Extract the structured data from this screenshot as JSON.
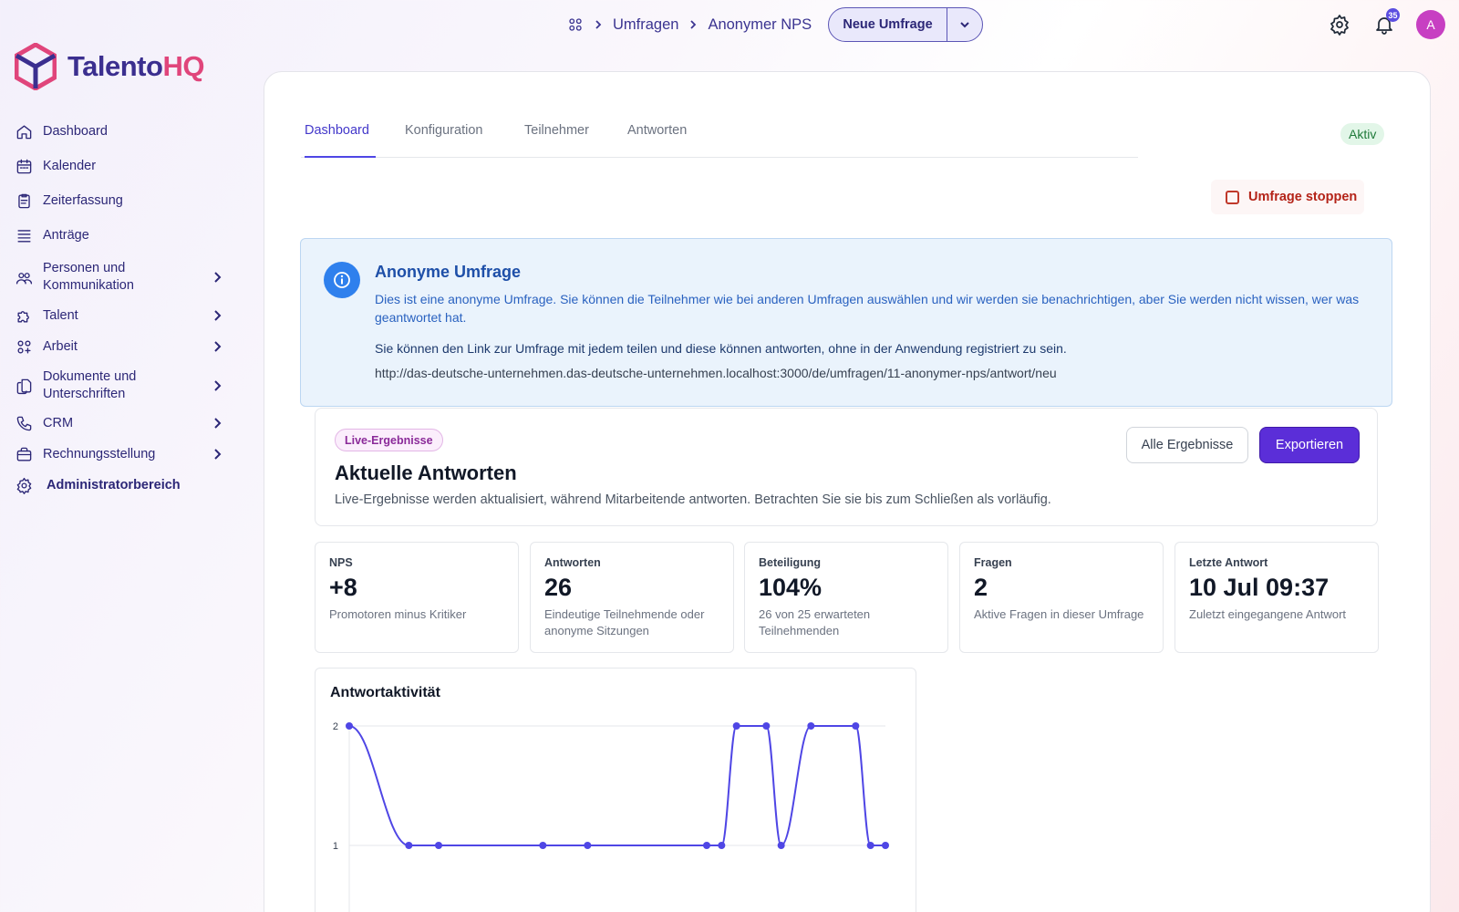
{
  "brand": {
    "name_part1": "Talento",
    "name_part2": "HQ",
    "color_primary": "#3b2f8f",
    "color_accent": "#e0457b"
  },
  "sidebar": {
    "items": [
      {
        "label": "Dashboard",
        "icon": "home-icon"
      },
      {
        "label": "Kalender",
        "icon": "calendar-icon"
      },
      {
        "label": "Zeiterfassung",
        "icon": "clipboard-icon"
      },
      {
        "label": "Anträge",
        "icon": "list-icon"
      },
      {
        "label": "Personen und Kommunikation",
        "icon": "people-icon",
        "has_children": true
      },
      {
        "label": "Talent",
        "icon": "puzzle-icon",
        "has_children": true
      },
      {
        "label": "Arbeit",
        "icon": "apps-icon",
        "has_children": true
      },
      {
        "label": "Dokumente und Unterschriften",
        "icon": "documents-icon",
        "has_children": true
      },
      {
        "label": "CRM",
        "icon": "phone-icon",
        "has_children": true
      },
      {
        "label": "Rechnungsstellung",
        "icon": "briefcase-icon",
        "has_children": true
      },
      {
        "label": "Administratorbereich",
        "icon": "gear-icon"
      }
    ]
  },
  "topbar": {
    "breadcrumb": [
      "Umfragen",
      "Anonymer NPS"
    ],
    "new_button": "Neue Umfrage",
    "notification_count": "35",
    "avatar_initial": "A"
  },
  "tabs": [
    "Dashboard",
    "Konfiguration",
    "Teilnehmer",
    "Antworten"
  ],
  "status": "Aktiv",
  "stop_button": "Umfrage stoppen",
  "info": {
    "title": "Anonyme Umfrage",
    "text1": "Dies ist eine anonyme Umfrage. Sie können die Teilnehmer wie bei anderen Umfragen auswählen und wir werden sie benachrichtigen, aber Sie werden nicht wissen, wer was geantwortet hat.",
    "text2": "Sie können den Link zur Umfrage mit jedem teilen und diese können antworten, ohne in der Anwendung registriert zu sein.",
    "link": "http://das-deutsche-unternehmen.das-deutsche-unternehmen.localhost:3000/de/umfragen/11-anonymer-nps/antwort/neu"
  },
  "live": {
    "chip": "Live-Ergebnisse",
    "title": "Aktuelle Antworten",
    "description": "Live-Ergebnisse werden aktualisiert, während Mitarbeitende antworten. Betrachten Sie sie bis zum Schließen als vorläufig.",
    "all_button": "Alle Ergebnisse",
    "export_button": "Exportieren"
  },
  "stats": [
    {
      "label": "NPS",
      "value": "+8",
      "sub": "Promotoren minus Kritiker"
    },
    {
      "label": "Antworten",
      "value": "26",
      "sub": "Eindeutige Teilnehmende oder anonyme Sitzungen"
    },
    {
      "label": "Beteiligung",
      "value": "104%",
      "sub": "26 von 25 erwarteten Teilnehmenden"
    },
    {
      "label": "Fragen",
      "value": "2",
      "sub": "Aktive Fragen in dieser Umfrage"
    },
    {
      "label": "Letzte Antwort",
      "value": "10 Jul 09:37",
      "sub": "Zuletzt eingegangene Antwort"
    }
  ],
  "chart_data": {
    "type": "line",
    "title": "Antwortaktivität",
    "y_ticks": [
      "2",
      "1"
    ],
    "ylim": [
      0,
      2
    ],
    "grid": true,
    "values": [
      2,
      1,
      1,
      1,
      1,
      1,
      1,
      2,
      2,
      1,
      2,
      2,
      1,
      1
    ],
    "x_positions": [
      0,
      4,
      6,
      13,
      16,
      24,
      25,
      26,
      28,
      29,
      31,
      34,
      35,
      36
    ],
    "x_range": [
      0,
      36
    ],
    "color": "#4f46e5"
  }
}
